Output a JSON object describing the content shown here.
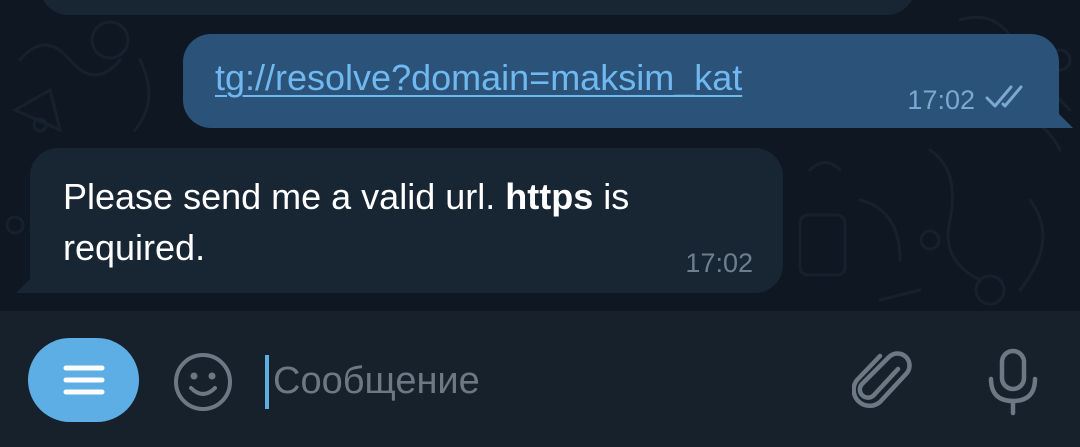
{
  "messages": {
    "outgoing": {
      "text": "tg://resolve?domain=maksim_kat",
      "time": "17:02",
      "status_icon": "double-check-icon"
    },
    "incoming": {
      "text_before": "Please send me a valid url. ",
      "text_bold": "https",
      "text_after": " is required.",
      "time": "17:02"
    }
  },
  "composer": {
    "placeholder": "Сообщение",
    "menu_icon": "menu-icon",
    "emoji_icon": "emoji-icon",
    "attach_icon": "paperclip-icon",
    "mic_icon": "microphone-icon"
  },
  "colors": {
    "chat_background": "#0f1722",
    "outgoing_bubble": "#2b5278",
    "incoming_bubble": "#182533",
    "link": "#70b8f0",
    "accent": "#5eaee6",
    "composer_background": "#17212b"
  }
}
